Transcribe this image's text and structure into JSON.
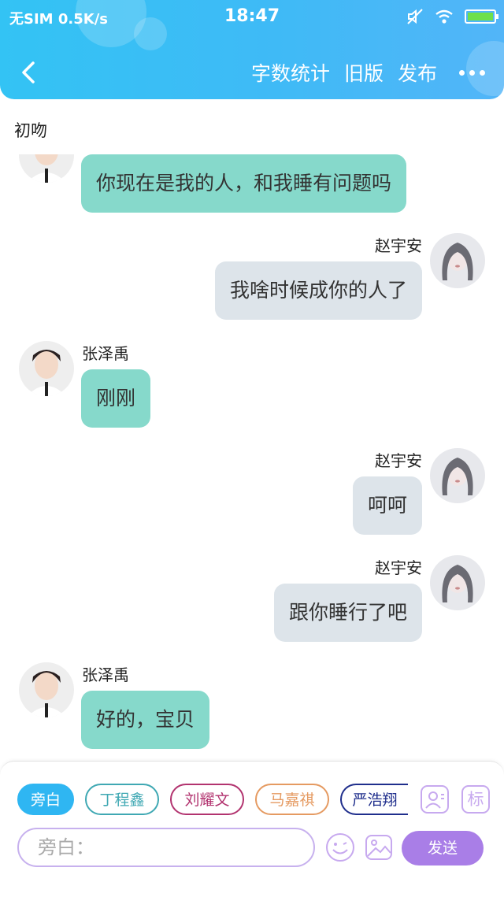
{
  "status_bar": {
    "carrier": "无SIM",
    "speed": "0.5K/s",
    "time": "18:47"
  },
  "nav": {
    "word_count": "字数统计",
    "old_version": "旧版",
    "publish": "发布"
  },
  "chapter_title": "初吻",
  "messages": [
    {
      "side": "left",
      "speaker": "",
      "text": "你现在是我的人，和我睡有问题吗"
    },
    {
      "side": "right",
      "speaker": "赵宇安",
      "text": "我啥时候成你的人了"
    },
    {
      "side": "left",
      "speaker": "张泽禹",
      "text": "刚刚"
    },
    {
      "side": "right",
      "speaker": "赵宇安",
      "text": "呵呵"
    },
    {
      "side": "right",
      "speaker": "赵宇安",
      "text": "跟你睡行了吧"
    },
    {
      "side": "left",
      "speaker": "张泽禹",
      "text": "好的，宝贝"
    }
  ],
  "roles": [
    {
      "label": "旁白",
      "color": "#2fb6f2",
      "selected": true
    },
    {
      "label": "丁程鑫",
      "color": "#3fa8b3",
      "selected": false
    },
    {
      "label": "刘耀文",
      "color": "#b2336f",
      "selected": false
    },
    {
      "label": "马嘉祺",
      "color": "#e59a61",
      "selected": false
    },
    {
      "label": "严浩翔",
      "color": "#1f2e8c",
      "selected": false
    }
  ],
  "composer": {
    "tag_button": "标",
    "placeholder": "旁白：",
    "send": "发送"
  }
}
